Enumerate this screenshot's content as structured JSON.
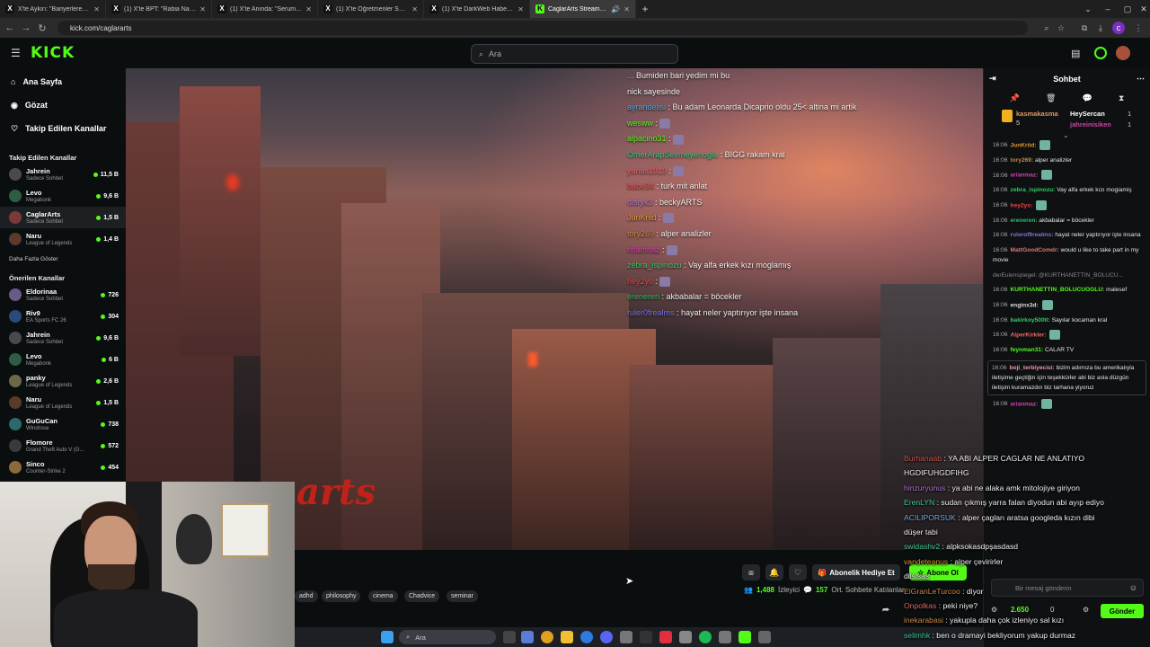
{
  "browser": {
    "tabs": [
      {
        "title": "X'te Aykırı: \"Bariyerlere çarpan ...",
        "color": "#333"
      },
      {
        "title": "(1) X'te BPT: \"Rabia Naz'ın babası...",
        "color": "#333"
      },
      {
        "title": "(1) X'te Anında: \"Serum takılı ol...",
        "color": "#333"
      },
      {
        "title": "(1) X'te Öğretmenler Sayfası \"B...",
        "color": "#333"
      },
      {
        "title": "(1) X'te DarkWeb Haber: \"Kahra...",
        "color": "#333"
      },
      {
        "title": "CaglarArts Stream - Watch ...",
        "color": "#53fc18"
      }
    ],
    "url": "kick.com/caglararts"
  },
  "header": {
    "logo": "KICK",
    "search_placeholder": "Ara"
  },
  "sidebar": {
    "nav": [
      {
        "label": "Ana Sayfa",
        "icon": "home-icon",
        "glyph": "⌂"
      },
      {
        "label": "Gözat",
        "icon": "compass-icon",
        "glyph": "◉"
      },
      {
        "label": "Takip Edilen Kanallar",
        "icon": "heart-icon",
        "glyph": "♡"
      }
    ],
    "followed_title": "Takip Edilen Kanallar",
    "followed": [
      {
        "name": "Jahrein",
        "category": "Sadece Sohbet",
        "viewers": "11,5 B",
        "color": "#4a4a4a"
      },
      {
        "name": "Levo",
        "category": "Megabonk",
        "viewers": "9,6 B",
        "color": "#2e5c44"
      },
      {
        "name": "CaglarArts",
        "category": "Sadece Sohbet",
        "viewers": "1,5 B",
        "color": "#7a3a3a"
      },
      {
        "name": "Naru",
        "category": "League of Legends",
        "viewers": "1,4 B",
        "color": "#5a3a2a"
      }
    ],
    "show_more": "Daha Fazla Göster",
    "recommended_title": "Önerilen Kanallar",
    "recommended": [
      {
        "name": "Eldorinaa",
        "category": "Sadece Sohbet",
        "viewers": "726",
        "color": "#6a5a8a"
      },
      {
        "name": "Riv9",
        "category": "EA Sports FC 26",
        "viewers": "304",
        "color": "#2a4a7a"
      },
      {
        "name": "Jahrein",
        "category": "Sadece Sohbet",
        "viewers": "9,6 B",
        "color": "#4a4a4a"
      },
      {
        "name": "Levo",
        "category": "Megabonk",
        "viewers": "6 B",
        "color": "#2e5c44"
      },
      {
        "name": "panky",
        "category": "League of Legends",
        "viewers": "2,6 B",
        "color": "#6a6a4a"
      },
      {
        "name": "Naru",
        "category": "League of Legends",
        "viewers": "1,5 B",
        "color": "#5a3a2a"
      },
      {
        "name": "GuGuCan",
        "category": "Windrose",
        "viewers": "738",
        "color": "#2a6a6a"
      },
      {
        "name": "Flomore",
        "category": "Grand Theft Auto V (G...",
        "viewers": "572",
        "color": "#3a3a3a"
      },
      {
        "name": "Sinco",
        "category": "Counter-Strike 2",
        "viewers": "454",
        "color": "#8a6a3a"
      }
    ]
  },
  "video_overlay_chat": [
    {
      "user": "...",
      "text": "Bumiden bari yedim mi bu",
      "ucolor": "#9ad"
    },
    {
      "user": "",
      "text": "nick sayesinde",
      "ucolor": "#ddd"
    },
    {
      "user": "ayrandelisi",
      "text": ": Bu adam Leonarda Dicaprio oldu 25< altina mi artik",
      "ucolor": "#5ad"
    },
    {
      "user": "wesww",
      "text": ":",
      "ucolor": "#53fc18"
    },
    {
      "user": "alpacino31",
      "text": ":",
      "ucolor": "#53fc18"
    },
    {
      "user": "OmerArapSevmeyenoglu",
      "text": ": BIGG rakam kral",
      "ucolor": "#3c8"
    },
    {
      "user": "yunus1919",
      "text": ":",
      "ucolor": "#e66"
    },
    {
      "user": "babe34",
      "text": ": turk mit anlat",
      "ucolor": "#d55"
    },
    {
      "user": "disryk3",
      "text": ": beckyARTS",
      "ucolor": "#a7c"
    },
    {
      "user": "JunKriid",
      "text": ":",
      "ucolor": "#d93"
    },
    {
      "user": "tory269",
      "text": ": alper analizler",
      "ucolor": "#c84"
    },
    {
      "user": "nifamnaz",
      "text": ":",
      "ucolor": "#c4a"
    },
    {
      "user": "zebra_ispinozu",
      "text": ": Vay alfa erkek kızı moglamış",
      "ucolor": "#3c6"
    },
    {
      "user": "hey2yo",
      "text": ":",
      "ucolor": "#e44"
    },
    {
      "user": "ereneren",
      "text": ": akbabalar = böcekler",
      "ucolor": "#3b6"
    },
    {
      "user": "ruler0frealms",
      "text": ": hayat neler yaptırıyor işte insana",
      "ucolor": "#77d"
    }
  ],
  "under_bar": {
    "tags": [
      "adhd",
      "philosophy",
      "cinema",
      "Chadvice",
      "seminar"
    ],
    "gift_label": "Abonelik Hediye Et",
    "subscribe_label": "Abone Ol",
    "viewers": "1,488",
    "viewers_label": "İzleyici",
    "avg": "157",
    "avg_label": "Ort. Sohbete Katılanlar"
  },
  "taskbar": {
    "search_label": "Ara"
  },
  "chat": {
    "title": "Sohbet",
    "pinned": {
      "left_user": "kasmakasma",
      "left_count": "5",
      "right_user1": "HeySercan",
      "right_count1": "1",
      "right_user2": "jahreinisiken",
      "right_count2": "1"
    },
    "messages": [
      {
        "time": "16:06",
        "user": "JunKriid:",
        "text": "",
        "ucolor": "#d93"
      },
      {
        "time": "16:06",
        "user": "tory269:",
        "text": "alper analizler",
        "ucolor": "#c84"
      },
      {
        "time": "16:06",
        "user": "arianmaz:",
        "text": "",
        "ucolor": "#c4a"
      },
      {
        "time": "16:06",
        "user": "zebra_ispinozu:",
        "text": "Vay alfa erkek kızı mogiamiş",
        "ucolor": "#3c6"
      },
      {
        "time": "16:06",
        "user": "hey2yo:",
        "text": "",
        "ucolor": "#e44"
      },
      {
        "time": "16:06",
        "user": "ereneren:",
        "text": "akbabalar = böcekler",
        "ucolor": "#3b6"
      },
      {
        "time": "16:06",
        "user": "rulerof9realms:",
        "text": "hayat neler yaptırıyor işte insana",
        "ucolor": "#77d"
      },
      {
        "time": "16:06",
        "user": "MattGoodComdr:",
        "text": "would u like to take part in my movie",
        "ucolor": "#d77"
      },
      {
        "time": "",
        "user": "",
        "text": "derEulenspiegel: @KURTHANETTIN_BOLUCU...",
        "ucolor": "#888"
      },
      {
        "time": "16:06",
        "user": "KURTHANETTIN_BOLUCUOGLU:",
        "text": "malesef",
        "ucolor": "#53fc18"
      },
      {
        "time": "16:06",
        "user": "enginx3d:",
        "text": "",
        "ucolor": "#ddd"
      },
      {
        "time": "16:06",
        "user": "bakirkoy500tl:",
        "text": "Sayılar kocaman kral",
        "ucolor": "#3c6"
      },
      {
        "time": "16:06",
        "user": "AlperKirkler:",
        "text": "",
        "ucolor": "#e66"
      },
      {
        "time": "16:06",
        "user": "feynman31:",
        "text": "CALAR TV",
        "ucolor": "#53fc18"
      },
      {
        "time": "16:06",
        "user": "boji_terbiyecisi:",
        "text": "bizim adımıza bu amerikalıyla iletişime geçtiğin için teşekkürler abi biz asla düzgün iletişim kuramazdın biz tarhana yiyoruz",
        "ucolor": "#e9a"
      },
      {
        "time": "16:06",
        "user": "arianmaz:",
        "text": "",
        "ucolor": "#c4a"
      }
    ],
    "input_placeholder": "Bir mesaj gönderin",
    "send_label": "Gönder",
    "points": "2.650",
    "count": "0"
  },
  "lower_overlay": [
    {
      "user": "Burhanaab",
      "text": ": YA ABI ALPER CAGLAR NE ANLATIYO",
      "ucolor": "#c55"
    },
    {
      "user": "",
      "text": "HGDIFUHGDFIHG",
      "ucolor": "#ddd"
    },
    {
      "user": "hinzuryunus",
      "text": ": ya abi ne alaka amk mitolojiye giriyon",
      "ucolor": "#a7c"
    },
    {
      "user": "ErenLYN",
      "text": ": sudan çıkmış yarra falan diyodun abi ayıp ediyo",
      "ucolor": "#4c9"
    },
    {
      "user": "ACILIPORSUK",
      "text": ": alper çagları aratsa googleda kızın dibi",
      "ucolor": "#7ad"
    },
    {
      "user": "",
      "text": "düşer tabi",
      "ucolor": "#ddd"
    },
    {
      "user": "swidashv2",
      "text": ": alpksokasdpşasdasd",
      "ucolor": "#4c9"
    },
    {
      "user": "vandeteanus",
      "text": ": alper çevirirler",
      "ucolor": "#d93"
    },
    {
      "user": "",
      "text": "dilslsas",
      "ucolor": "#ddd"
    },
    {
      "user": "ElGranLeTurcoo",
      "text": ": diyor",
      "ucolor": "#c84"
    },
    {
      "user": "Onpolkas",
      "text": ": peki niye?",
      "ucolor": "#d66"
    },
    {
      "user": "inekarabasi",
      "text": ": yakupla daha çok izleniyo sal kızı",
      "ucolor": "#c84"
    },
    {
      "user": "selimhk",
      "text": ": ben o dramayi bekliyorum yakup durmaz",
      "ucolor": "#3c9"
    }
  ],
  "stream_watermark": "arts"
}
